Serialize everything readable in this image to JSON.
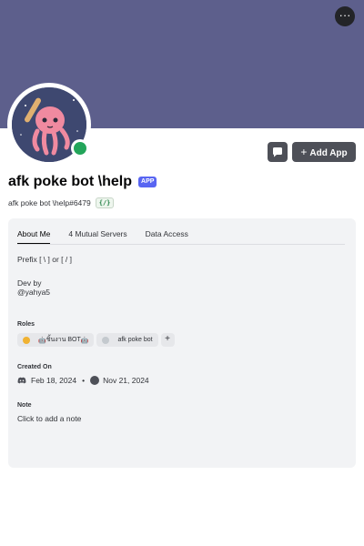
{
  "header": {
    "more_label": "···"
  },
  "actions": {
    "add_app_icon": "plus-icon",
    "add_app_label": "Add App",
    "message_icon": "speech-bubble-icon"
  },
  "profile": {
    "display_name": "afk poke bot \\help",
    "tag": "APP",
    "username": "afk poke bot \\help#6479",
    "badge": "{/}",
    "status_color": "#23a55a"
  },
  "tabs": [
    "About Me",
    "4 Mutual Servers",
    "Data Access"
  ],
  "about": {
    "line1": "Prefix [ \\ ] or [ / ]",
    "line2": "Dev by",
    "line3": "@yahya5"
  },
  "roles": {
    "title": "Roles",
    "items": [
      {
        "label": "ชิ้นงาน BOT",
        "prefix": "🤖",
        "suffix": "🤖",
        "color": "#f0b232"
      },
      {
        "label": "afk poke bot",
        "color": "#c4c9ce"
      }
    ],
    "add_label": "+"
  },
  "created": {
    "title": "Created On",
    "discord_date": "Feb 18, 2024",
    "separator": "•",
    "server_date": "Nov 21, 2024"
  },
  "note": {
    "title": "Note",
    "placeholder": "Click to add a note"
  }
}
